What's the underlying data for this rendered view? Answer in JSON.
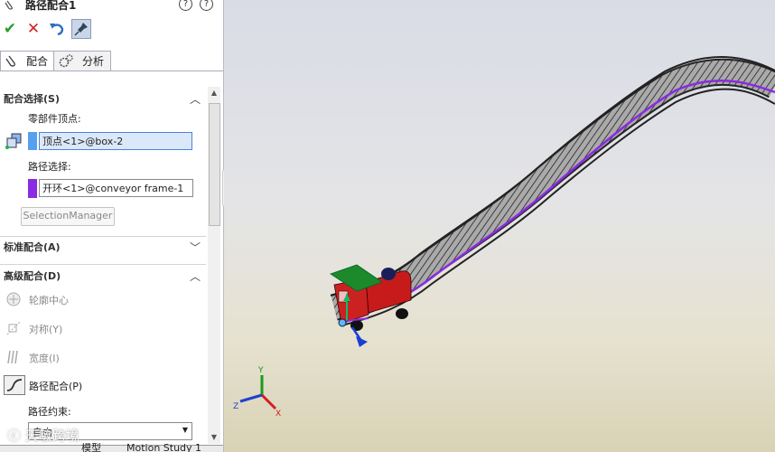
{
  "panel": {
    "title": "路径配合1",
    "help_icons": [
      "?",
      "?"
    ],
    "tabs": [
      {
        "label": "配合"
      },
      {
        "label": "分析"
      }
    ],
    "mate_selection": {
      "header": "配合选择(S)",
      "vertex_label": "零部件顶点:",
      "vertex_value": "顶点<1>@box-2",
      "path_label": "路径选择:",
      "path_value": "开环<1>@conveyor frame-1",
      "selection_manager": "SelectionManager"
    },
    "standard_mates": {
      "header": "标准配合(A)"
    },
    "advanced_mates": {
      "header": "高级配合(D)",
      "items": [
        {
          "label": "轮廓中心",
          "icon": "profile-center-icon",
          "enabled": false
        },
        {
          "label": "对称(Y)",
          "icon": "symmetric-icon",
          "enabled": false
        },
        {
          "label": "宽度(I)",
          "icon": "width-icon",
          "enabled": false
        },
        {
          "label": "路径配合(P)",
          "icon": "path-mate-icon",
          "enabled": true
        }
      ],
      "constraint_label": "路径约束:",
      "constraint_value": "自由"
    },
    "bottom_tabs": [
      {
        "label": "模型"
      },
      {
        "label": "Motion Study 1"
      }
    ]
  },
  "watermark": "天敏跨境",
  "triad": {
    "x": "X",
    "y": "Y",
    "z": "Z"
  },
  "colors": {
    "accent": "#2f6fd6",
    "path": "#8a2be2",
    "confirm": "#2a9d2a",
    "cancel": "#d22222"
  }
}
